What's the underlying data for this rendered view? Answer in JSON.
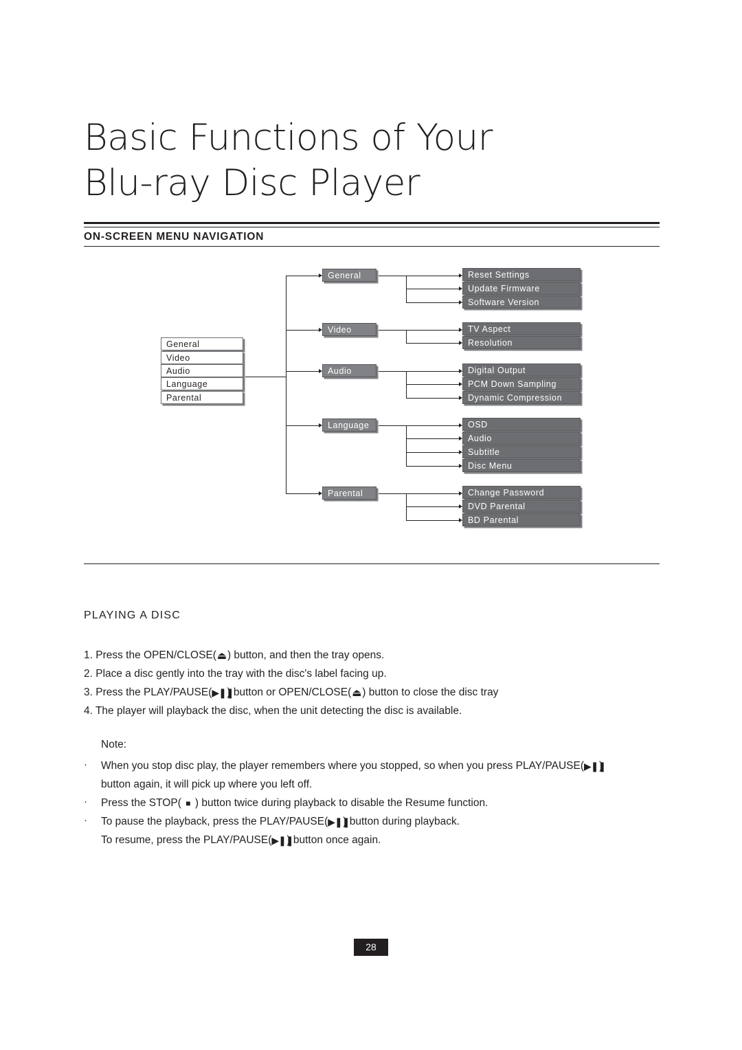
{
  "title": {
    "line1": "Basic Functions of Your",
    "line2": "Blu-ray Disc Player"
  },
  "section_heading": "ON-SCREEN MENU NAVIGATION",
  "diagram": {
    "left_menu": [
      "General",
      "Video",
      "Audio",
      "Language",
      "Parental"
    ],
    "columns": [
      {
        "category": "General",
        "items": [
          "Reset Settings",
          "Update Firmware",
          "Software Version"
        ]
      },
      {
        "category": "Video",
        "items": [
          "TV Aspect",
          "Resolution"
        ]
      },
      {
        "category": "Audio",
        "items": [
          "Digital Output",
          "PCM Down Sampling",
          "Dynamic Compression"
        ]
      },
      {
        "category": "Language",
        "items": [
          "OSD",
          "Audio",
          "Subtitle",
          "Disc Menu"
        ]
      },
      {
        "category": "Parental",
        "items": [
          "Change Password",
          "DVD Parental",
          "BD Parental"
        ]
      }
    ]
  },
  "playing": {
    "heading": "PLAYING A DISC",
    "step1_a": "1. Press the OPEN/CLOSE(",
    "step1_b": ") button, and then the tray opens.",
    "step2": "2. Place a disc gently into the tray with the disc's label facing up.",
    "step3_a": "3. Press the PLAY/PAUSE(",
    "step3_b": ") button or OPEN/CLOSE(",
    "step3_c": ") button to close the disc tray",
    "step4": "4. The player will playback the disc, when the unit detecting the disc is available."
  },
  "note": {
    "label": "Note:",
    "bullet": "·",
    "n1_a": "When you stop disc play, the player remembers where you stopped, so when you press PLAY/PAUSE(",
    "n1_b": ")",
    "n1_cont": "button again, it will pick up where you left off.",
    "n2_a": "Press the STOP(",
    "n2_b": ") button twice during playback to disable the Resume function.",
    "n3_a": "To pause the playback, press the PLAY/PAUSE(",
    "n3_b": ") button during playback.",
    "n3_cont_a": "To resume, press the PLAY/PAUSE(",
    "n3_cont_b": ") button once again."
  },
  "icons": {
    "eject": "⏏",
    "play_pause": "▶❚❚",
    "stop": "■"
  },
  "footer": {
    "page_number": "28"
  }
}
